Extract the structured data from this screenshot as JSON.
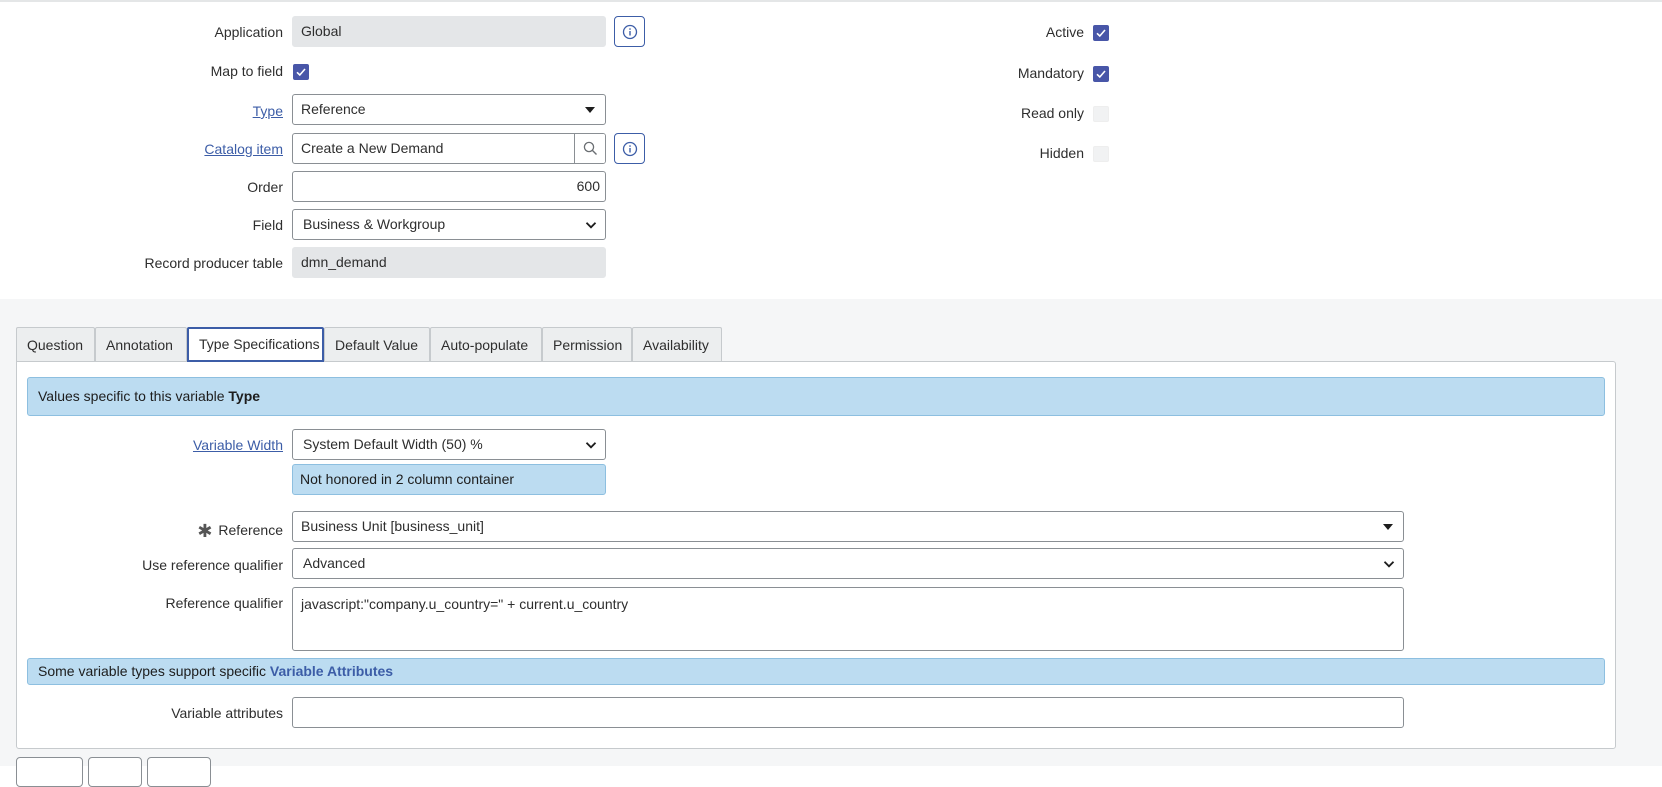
{
  "form": {
    "application": {
      "label": "Application",
      "value": "Global"
    },
    "map_to_field": {
      "label": "Map to field",
      "checked": true
    },
    "type": {
      "label": "Type",
      "value": "Reference"
    },
    "catalog_item": {
      "label": "Catalog item",
      "value": "Create a New Demand"
    },
    "order": {
      "label": "Order",
      "value": "600"
    },
    "field": {
      "label": "Field",
      "value": "Business & Workgroup"
    },
    "record_producer_table": {
      "label": "Record producer table",
      "value": "dmn_demand"
    },
    "active": {
      "label": "Active",
      "checked": true
    },
    "mandatory": {
      "label": "Mandatory",
      "checked": true
    },
    "read_only": {
      "label": "Read only",
      "checked": false
    },
    "hidden": {
      "label": "Hidden",
      "checked": false
    }
  },
  "tabs": [
    {
      "label": "Question",
      "active": false
    },
    {
      "label": "Annotation",
      "active": false
    },
    {
      "label": "Type Specifications",
      "active": true
    },
    {
      "label": "Default Value",
      "active": false
    },
    {
      "label": "Auto-populate",
      "active": false
    },
    {
      "label": "Permission",
      "active": false
    },
    {
      "label": "Availability",
      "active": false
    }
  ],
  "type_spec": {
    "info_prefix": "Values specific to this variable ",
    "info_bold": "Type",
    "variable_width": {
      "label": "Variable Width",
      "value": "System Default Width (50) %"
    },
    "width_note": "Not honored in 2 column container",
    "reference": {
      "label": "Reference",
      "value": "Business Unit [business_unit]"
    },
    "use_reference_qualifier": {
      "label": "Use reference qualifier",
      "value": "Advanced"
    },
    "reference_qualifier": {
      "label": "Reference qualifier",
      "value": "javascript:\"company.u_country=\" + current.u_country"
    },
    "attributes_info_prefix": "Some variable types support specific ",
    "attributes_info_link": "Variable Attributes",
    "variable_attributes": {
      "label": "Variable attributes",
      "value": ""
    }
  },
  "colors": {
    "accent": "#3c5da7",
    "checkbox": "#4856a8",
    "info_bg": "#bcdcf1"
  }
}
